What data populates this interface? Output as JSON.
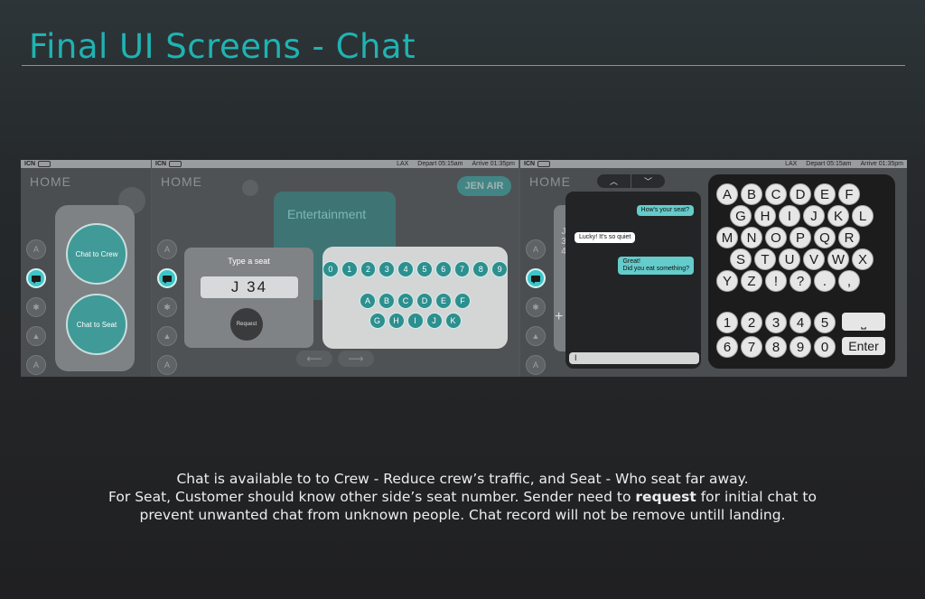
{
  "page_title": "Final UI Screens - Chat",
  "status": {
    "origin": "ICN",
    "destination": "LAX",
    "depart_label": "Depart",
    "depart_time": "05:15am",
    "arrive_label": "Arrive",
    "arrive_time": "01:35pm"
  },
  "panel1": {
    "home": "HOME",
    "chat_to_crew": "Chat to Crew",
    "chat_to_seat": "Chat to Seat"
  },
  "panel2": {
    "home": "HOME",
    "airline": "JEN AIR",
    "entertainment": "Entertainment",
    "type_seat_label": "Type a seat",
    "seat_value": "J 34",
    "request_label": "Request",
    "number_keys": [
      "0",
      "1",
      "2",
      "3",
      "4",
      "5",
      "6",
      "7",
      "8",
      "9"
    ],
    "letter_keys_row1": [
      "A",
      "B",
      "C",
      "D",
      "E",
      "F"
    ],
    "letter_keys_row2": [
      "G",
      "H",
      "I",
      "J",
      "K"
    ],
    "prev_arrow": "⟵",
    "next_arrow": "⟶"
  },
  "panel3": {
    "home": "HOME",
    "seat_chars": [
      "J",
      "3",
      "4"
    ],
    "plus": "+",
    "up_arrow": "︿",
    "down_arrow": "﹀",
    "messages": [
      {
        "text": "How's your seat?",
        "from": "me"
      },
      {
        "text": "Lucky! It's so quiet",
        "from": "other"
      },
      {
        "text": "Great!\nDid you eat something?",
        "from": "me"
      }
    ],
    "input_value": "I",
    "keyboard_rows": [
      [
        "A",
        "B",
        "C",
        "D",
        "E",
        "F"
      ],
      [
        "G",
        "H",
        "I",
        "J",
        "K",
        "L"
      ],
      [
        "M",
        "N",
        "O",
        "P",
        "Q",
        "R"
      ],
      [
        "S",
        "T",
        "U",
        "V",
        "W",
        "X"
      ],
      [
        "Y",
        "Z",
        "!",
        "?",
        ".",
        ","
      ]
    ],
    "number_row1": [
      "1",
      "2",
      "3",
      "4",
      "5"
    ],
    "number_row2": [
      "6",
      "7",
      "8",
      "9",
      "0"
    ],
    "space_key": "⎵",
    "enter_key": "Enter"
  },
  "caption": {
    "line1": "Chat is available to to Crew - Reduce crew’s traffic, and Seat - Who seat far away.",
    "line2_pre": "For Seat, Customer should know other side’s seat number. Sender need to ",
    "line2_bold": "request",
    "line2_post": " for initial chat to",
    "line3": "prevent unwanted chat from unknown people. Chat record will not be remove untill landing."
  },
  "colors": {
    "accent": "#1fb3b2",
    "teal_key": "#2d8f8e",
    "bubble_teal": "#64cccb"
  }
}
